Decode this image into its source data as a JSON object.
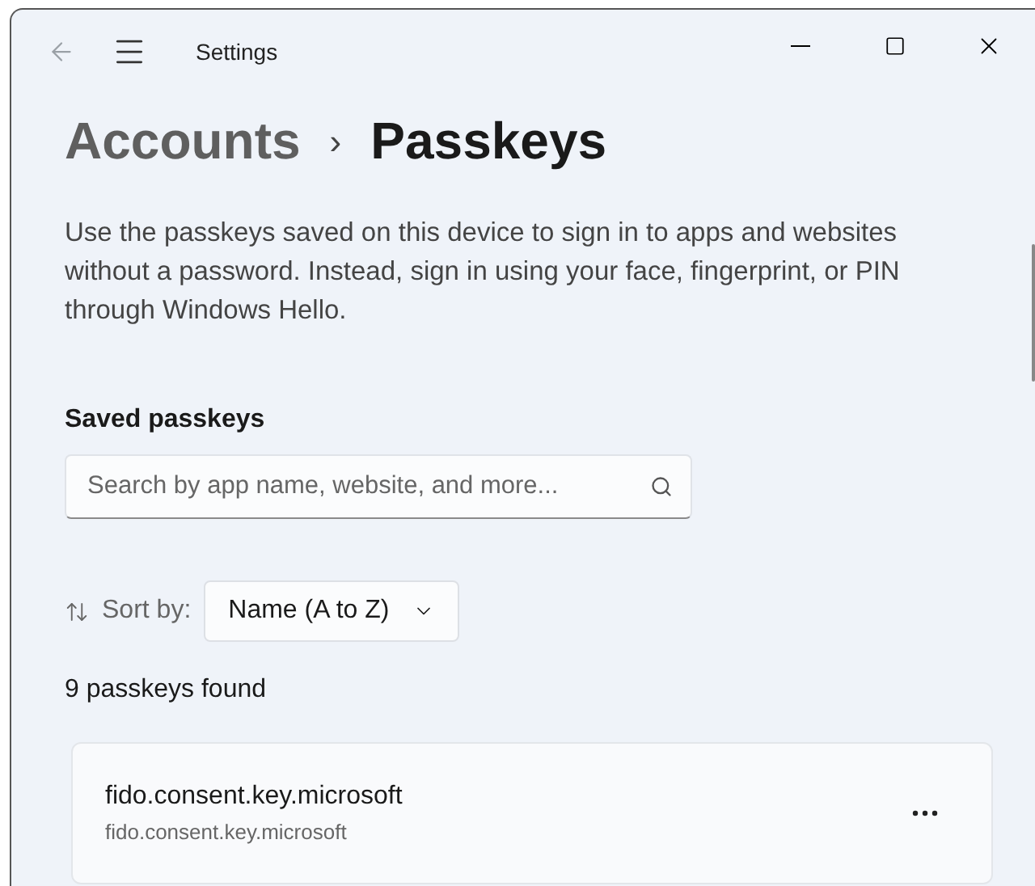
{
  "window": {
    "title": "Settings"
  },
  "breadcrumb": {
    "parent": "Accounts",
    "separator": "›",
    "current": "Passkeys"
  },
  "description": "Use the passkeys saved on this device to sign in to apps and websites without a password. Instead, sign in using your face, fingerprint, or PIN through Windows Hello.",
  "section_title": "Saved passkeys",
  "search": {
    "placeholder": "Search by app name, website, and more..."
  },
  "sort": {
    "label": "Sort by:",
    "value": "Name (A to Z)"
  },
  "count": "9 passkeys found",
  "passkeys": [
    {
      "name": "fido.consent.key.microsoft",
      "site": "fido.consent.key.microsoft"
    }
  ]
}
